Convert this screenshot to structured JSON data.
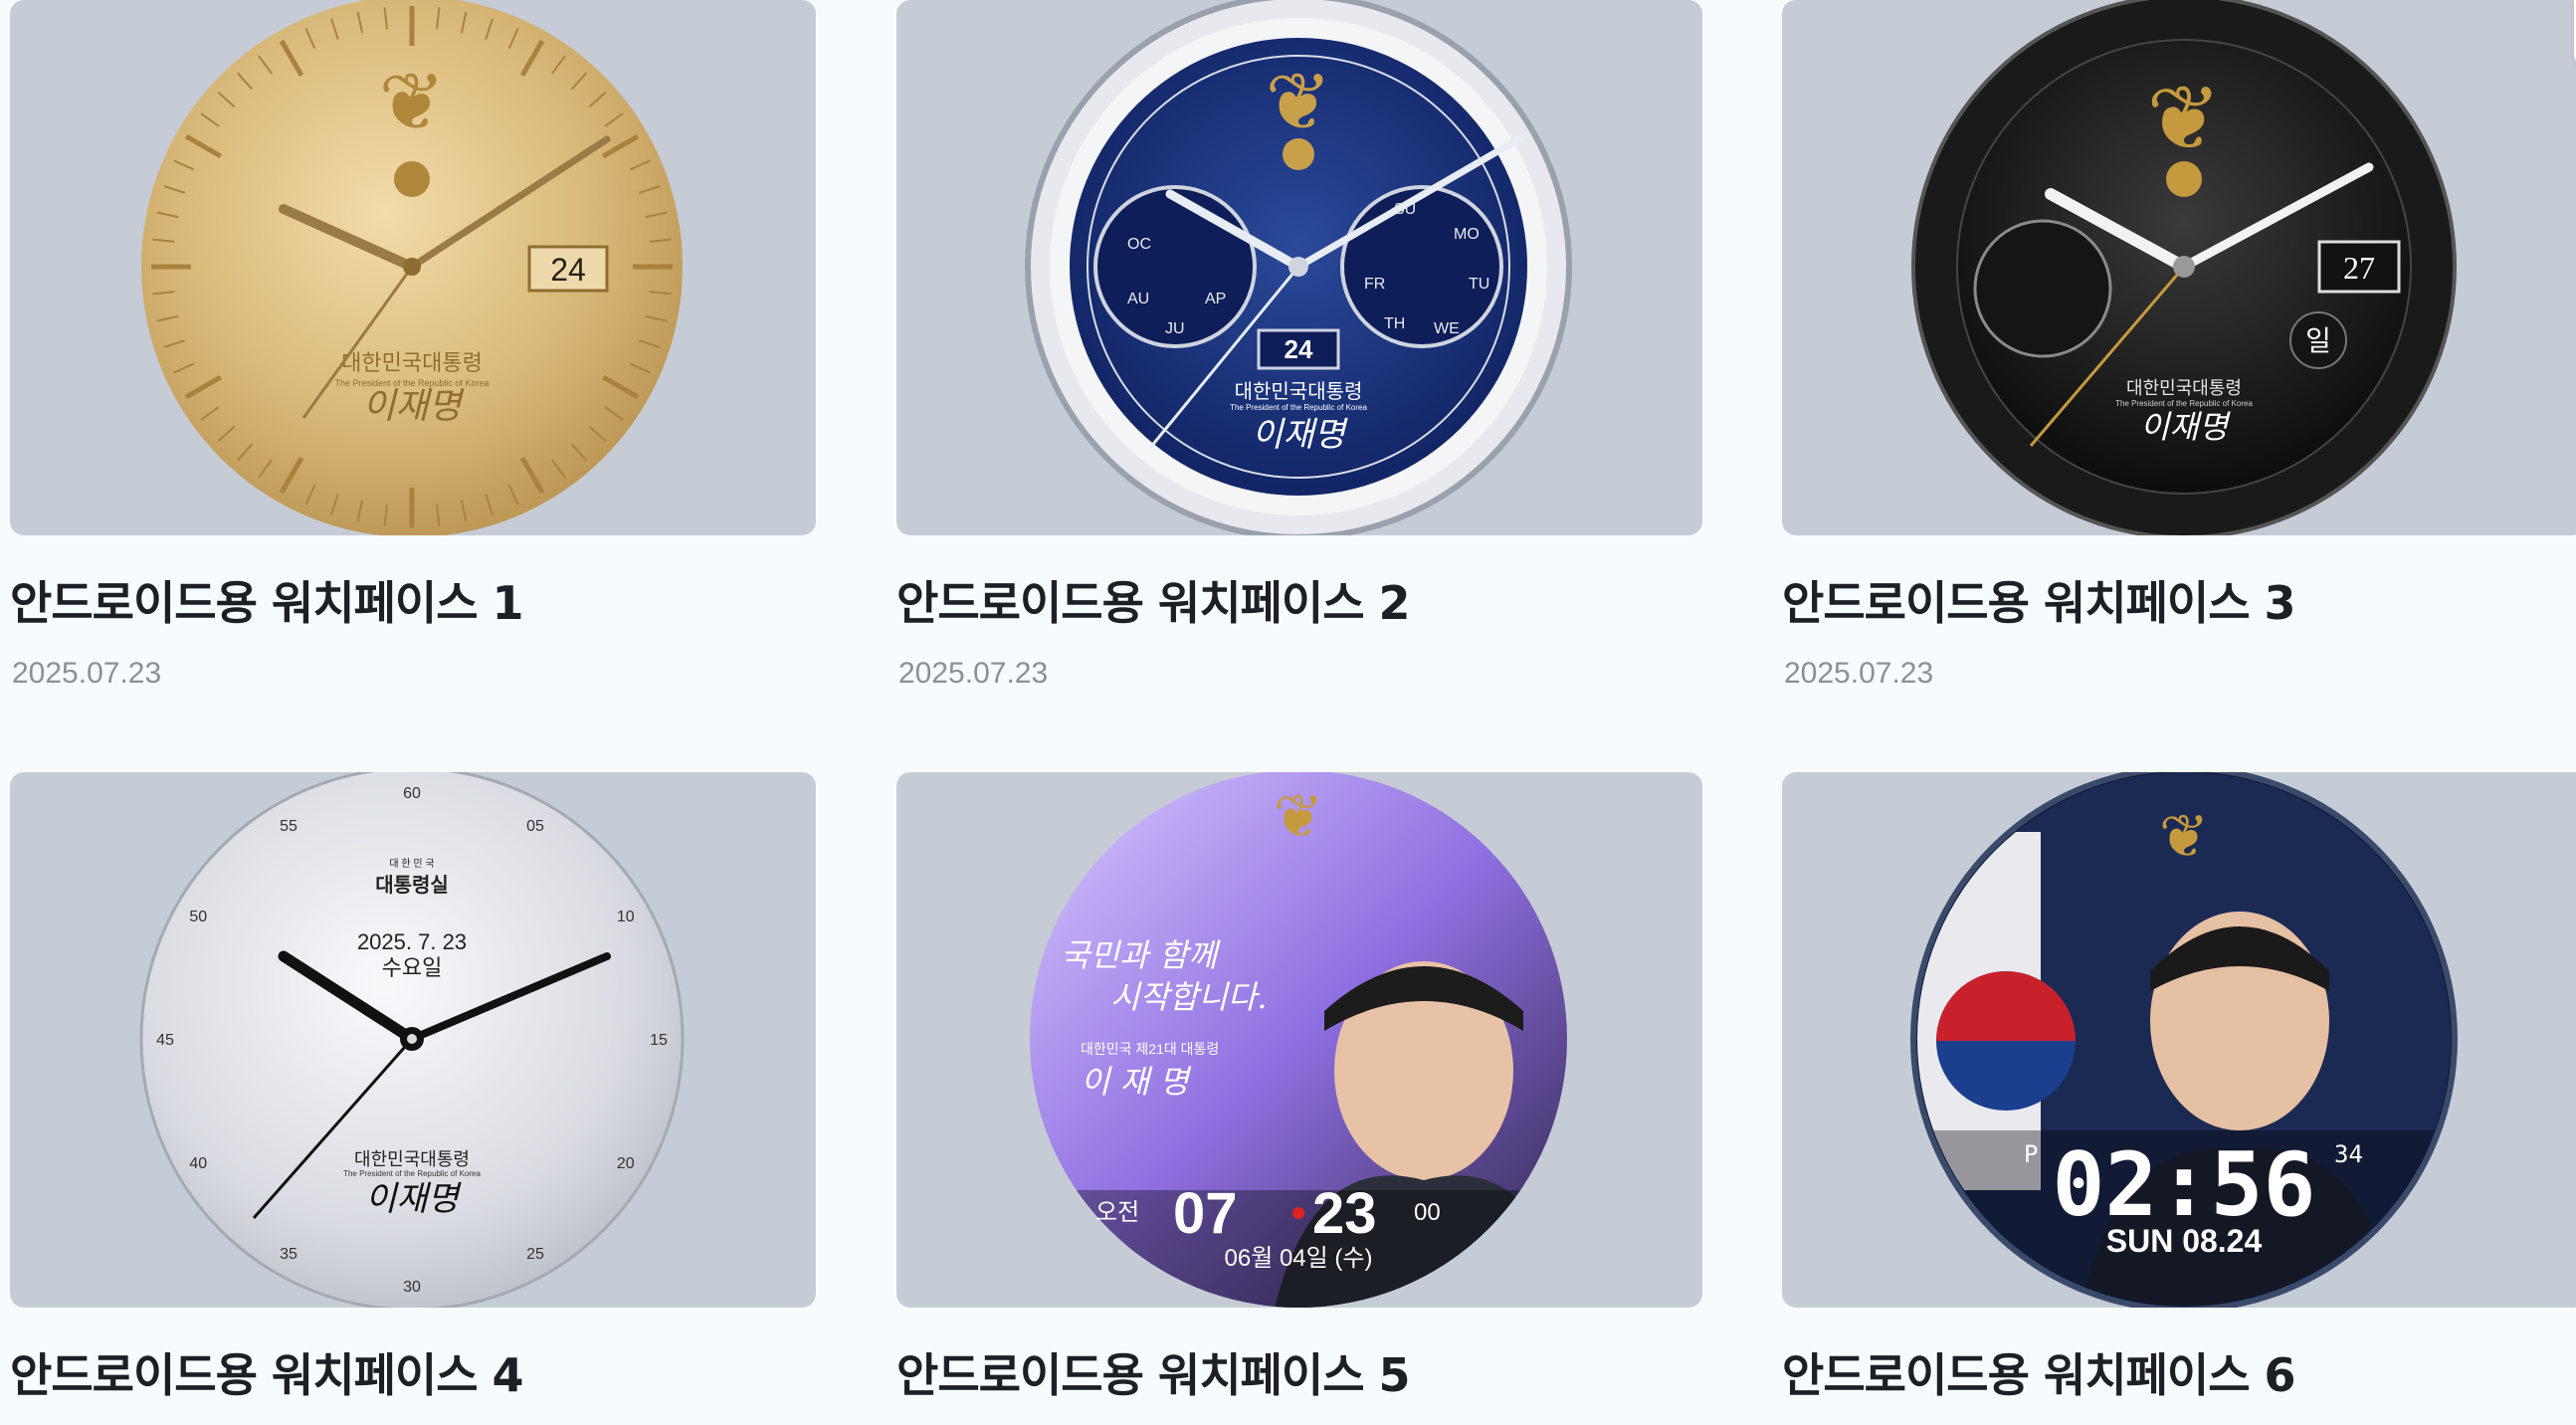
{
  "cards": [
    {
      "title": "안드로이드용 워치페이스 1",
      "date": "2025.07.23",
      "face": {
        "date_window": "24",
        "emblem_title": "대한민국대통령",
        "emblem_sub": "The President of the Republic of Korea",
        "signature": "이재명"
      }
    },
    {
      "title": "안드로이드용 워치페이스 2",
      "date": "2025.07.23",
      "face": {
        "date_window": "24",
        "emblem_title": "대한민국대통령",
        "emblem_sub": "The President of the Republic of Korea",
        "signature": "이재명",
        "left_dial": [
          "OC",
          "AU",
          "JU",
          "AP"
        ],
        "right_dial": [
          "MO",
          "TU",
          "WE",
          "TH",
          "FR",
          "SU"
        ]
      }
    },
    {
      "title": "안드로이드용 워치페이스 3",
      "date": "2025.07.23",
      "face": {
        "date_window": "27",
        "day": "일",
        "emblem_title": "대한민국대통령",
        "emblem_sub": "The President of the Republic of Korea",
        "signature": "이재명"
      }
    },
    {
      "title": "안드로이드용 워치페이스 4",
      "date": "",
      "face": {
        "header_small": "대 한 민 국",
        "header": "대통령실",
        "date_text": "2025. 7. 23",
        "weekday": "수요일",
        "emblem_title": "대한민국대통령",
        "emblem_sub": "The President of the Republic of Korea",
        "signature": "이재명",
        "numbers": [
          "60",
          "05",
          "10",
          "15",
          "20",
          "25",
          "30",
          "35",
          "40",
          "45",
          "50",
          "55"
        ]
      }
    },
    {
      "title": "안드로이드용 워치페이스 5",
      "date": "",
      "face": {
        "slogan1": "국민과 함께",
        "slogan2": "시작합니다.",
        "caption": "대한민국 제21대 대통령",
        "signature": "이 재 명",
        "ampm": "오전",
        "time_h": "07",
        "time_m": "23",
        "seconds": "00",
        "date_line": "06월 04일 (수)"
      }
    },
    {
      "title": "안드로이드용 워치페이스 6",
      "date": "",
      "face": {
        "ampm": "P",
        "time": "02:56",
        "seconds": "34",
        "date_line": "SUN 08.24"
      }
    }
  ],
  "colors": {
    "page_bg": "#f6fbfe",
    "thumb_bg": "#c5ccd5",
    "title": "#1c1f24",
    "date": "#8b9097"
  }
}
